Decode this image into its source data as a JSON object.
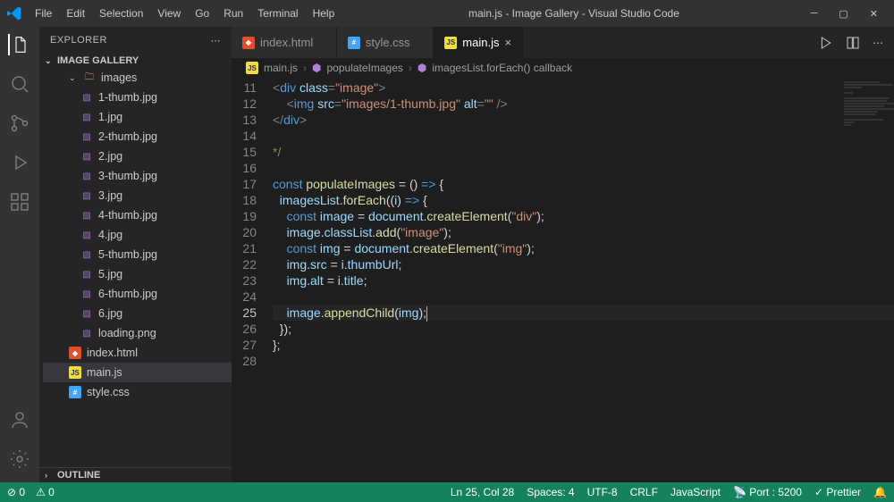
{
  "window": {
    "title": "main.js - Image Gallery - Visual Studio Code",
    "menu": [
      "File",
      "Edit",
      "Selection",
      "View",
      "Go",
      "Run",
      "Terminal",
      "Help"
    ]
  },
  "sidebar": {
    "title": "EXPLORER",
    "project": "IMAGE GALLERY",
    "folder": "images",
    "files": [
      {
        "name": "1-thumb.jpg",
        "icon": "img"
      },
      {
        "name": "1.jpg",
        "icon": "img"
      },
      {
        "name": "2-thumb.jpg",
        "icon": "img"
      },
      {
        "name": "2.jpg",
        "icon": "img"
      },
      {
        "name": "3-thumb.jpg",
        "icon": "img"
      },
      {
        "name": "3.jpg",
        "icon": "img"
      },
      {
        "name": "4-thumb.jpg",
        "icon": "img"
      },
      {
        "name": "4.jpg",
        "icon": "img"
      },
      {
        "name": "5-thumb.jpg",
        "icon": "img"
      },
      {
        "name": "5.jpg",
        "icon": "img"
      },
      {
        "name": "6-thumb.jpg",
        "icon": "img"
      },
      {
        "name": "6.jpg",
        "icon": "img"
      },
      {
        "name": "loading.png",
        "icon": "img"
      }
    ],
    "rootFiles": [
      {
        "name": "index.html",
        "icon": "html"
      },
      {
        "name": "main.js",
        "icon": "js",
        "selected": true
      },
      {
        "name": "style.css",
        "icon": "css"
      }
    ],
    "outline": "OUTLINE"
  },
  "tabs": [
    {
      "name": "index.html",
      "icon": "html"
    },
    {
      "name": "style.css",
      "icon": "css"
    },
    {
      "name": "main.js",
      "icon": "js",
      "active": true
    }
  ],
  "breadcrumbs": {
    "file": "main.js",
    "fn1": "populateImages",
    "fn2": "imagesList.forEach() callback"
  },
  "code": {
    "startLine": 11,
    "currentLine": 25,
    "lines": [
      {
        "html": "<span class='tag'>&lt;</span><span class='tagname'>div</span> <span class='attr'>class</span><span class='tag'>=</span><span class='str'>\"image\"</span><span class='tag'>&gt;</span>"
      },
      {
        "html": "    <span class='tag'>&lt;</span><span class='tagname'>img</span> <span class='attr'>src</span><span class='tag'>=</span><span class='str'>\"images/1-thumb.jpg\"</span> <span class='attr'>alt</span><span class='tag'>=</span><span class='str'>\"\"</span> <span class='tag'>/&gt;</span>"
      },
      {
        "html": "<span class='tag'>&lt;/</span><span class='tagname'>div</span><span class='tag'>&gt;</span>"
      },
      {
        "html": ""
      },
      {
        "html": "<span class='cmt'>*/</span>"
      },
      {
        "html": ""
      },
      {
        "html": "<span class='kw'>const</span> <span class='fn'>populateImages</span> = () <span class='kw'>=&gt;</span> {"
      },
      {
        "html": "  <span class='var'>imagesList</span>.<span class='fn'>forEach</span>((<span class='var'>i</span>) <span class='kw'>=&gt;</span> {"
      },
      {
        "html": "    <span class='kw'>const</span> <span class='var'>image</span> = <span class='var'>document</span>.<span class='fn'>createElement</span>(<span class='str'>\"div\"</span>);"
      },
      {
        "html": "    <span class='var'>image</span>.<span class='var'>classList</span>.<span class='fn'>add</span>(<span class='str'>\"image\"</span>);"
      },
      {
        "html": "    <span class='kw'>const</span> <span class='var'>img</span> = <span class='var'>document</span>.<span class='fn'>createElement</span>(<span class='str'>\"img\"</span>);"
      },
      {
        "html": "    <span class='var'>img</span>.<span class='var'>src</span> = <span class='var'>i</span>.<span class='var'>thumbUrl</span>;"
      },
      {
        "html": "    <span class='var'>img</span>.<span class='var'>alt</span> = <span class='var'>i</span>.<span class='var'>title</span>;"
      },
      {
        "html": ""
      },
      {
        "html": "    <span class='var'>image</span>.<span class='fn'>appendChild</span>(<span class='var'>img</span>);<span class='cursor'></span>",
        "current": true
      },
      {
        "html": "  });"
      },
      {
        "html": "};"
      },
      {
        "html": ""
      }
    ]
  },
  "status": {
    "errors": "0",
    "warnings": "0",
    "pos": "Ln 25, Col 28",
    "spaces": "Spaces: 4",
    "enc": "UTF-8",
    "eol": "CRLF",
    "lang": "JavaScript",
    "port": "Port : 5200",
    "prettier": "Prettier"
  }
}
